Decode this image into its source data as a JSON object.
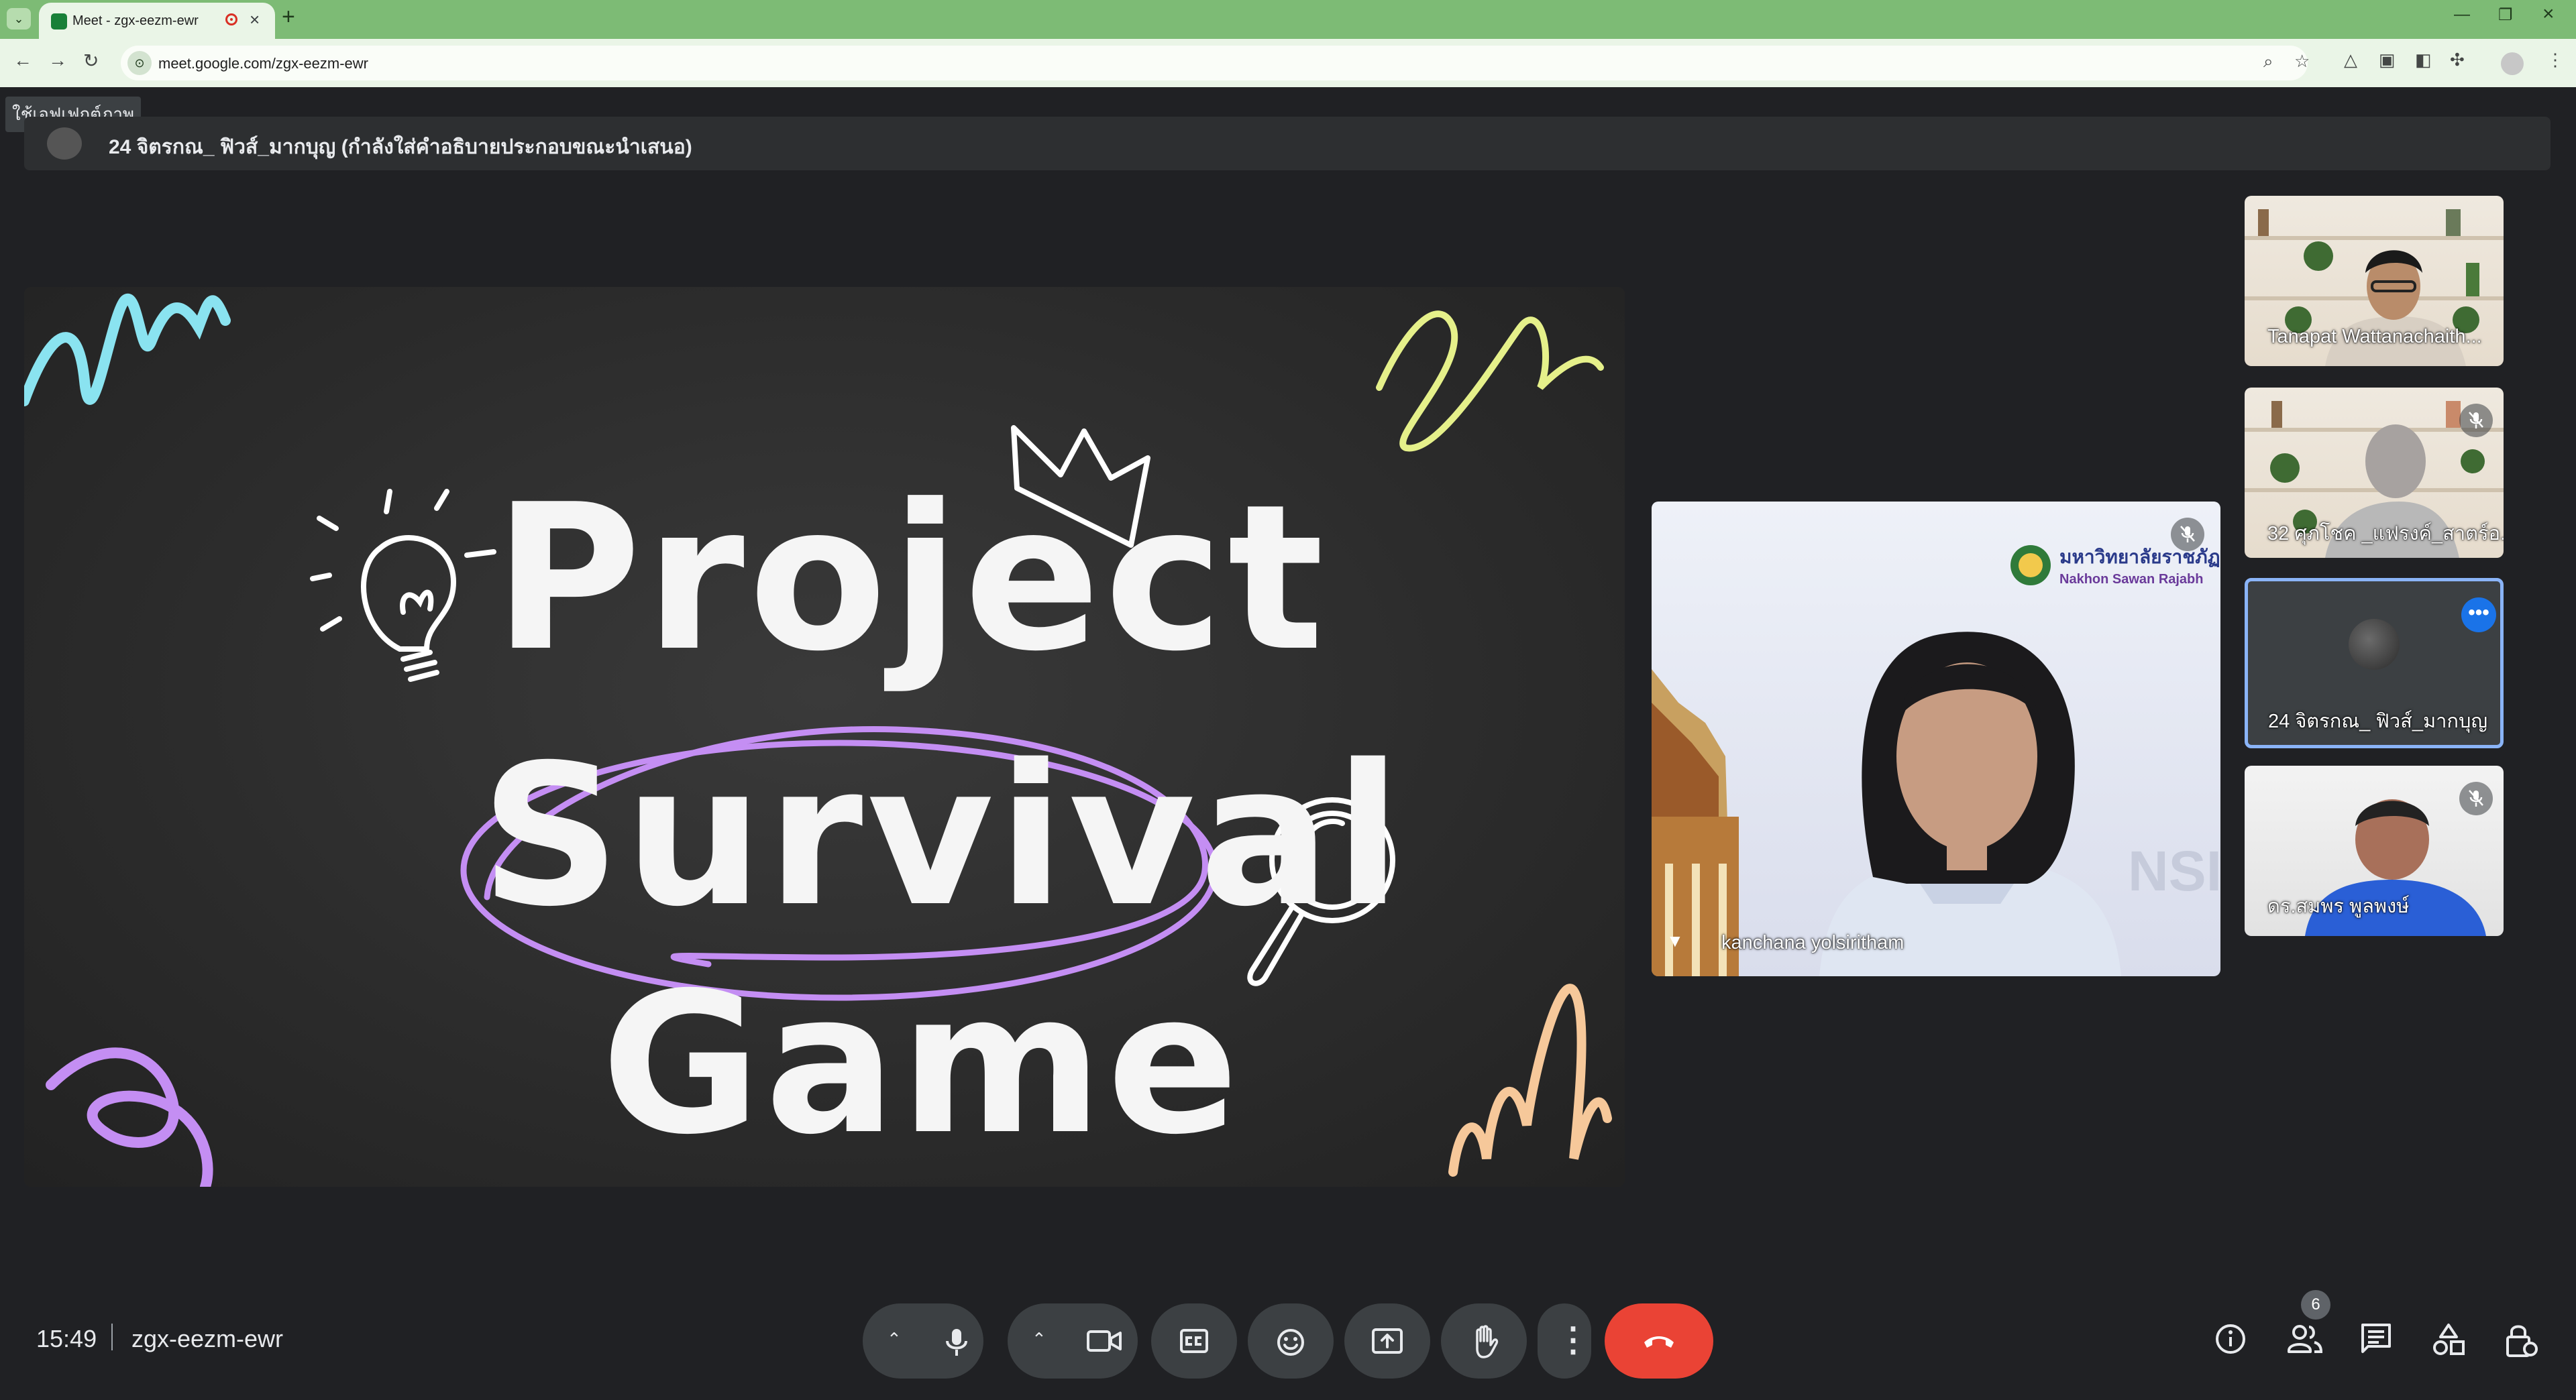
{
  "browser": {
    "tab_title": "Meet - zgx-eezm-ewr",
    "url": "meet.google.com/zgx-eezm-ewr"
  },
  "meet": {
    "effects_tooltip": "ใช้เอฟเฟกต์ภาพ",
    "presenter_label": "24 จิตรกณ_ ฟิวส์_มากบุญ (กำลังใส่คำอธิบายประกอบขณะนำเสนอ)",
    "slide": {
      "line1": "Project",
      "line2": "Survival",
      "line3": "Game"
    },
    "featured": {
      "name": "kanchana yolsiritham",
      "banner_th": "มหาวิทยาลัยราชภัฏ",
      "banner_en": "Nakhon Sawan Rajabh",
      "watermark": "NSI"
    },
    "participants": [
      {
        "name": "Tanapat Wattanachaith...",
        "muted": false
      },
      {
        "name": "32 ศุภโชค _แฟรงค์_สาตร์อ...",
        "muted": true
      },
      {
        "name": "24 จิตรกณ_ ฟิวส์_มากบุญ",
        "muted": false,
        "active": true
      },
      {
        "name": "ดร.สมพร พูลพงษ์",
        "muted": true
      }
    ],
    "time": "15:49",
    "meeting_code": "zgx-eezm-ewr",
    "people_count": "6"
  },
  "icons": {
    "mic": "mic-icon",
    "camera": "camera-icon",
    "captions": "captions-icon",
    "emoji": "emoji-icon",
    "present": "present-icon",
    "hand": "raise-hand-icon",
    "more": "more-vert-icon",
    "end": "end-call-icon",
    "info": "info-icon",
    "people": "people-icon",
    "chat": "chat-icon",
    "activities": "activities-icon",
    "host": "host-controls-icon"
  },
  "colors": {
    "tabstrip": "#7dbb75",
    "meet_bg": "#202124",
    "end_call": "#ea4335",
    "active_tile_border": "#8ab4f8",
    "slide_purple": "#c48ef3",
    "slide_cyan": "#8ae3f0",
    "slide_yellow": "#e5f08a",
    "slide_peach": "#f6c89a"
  }
}
